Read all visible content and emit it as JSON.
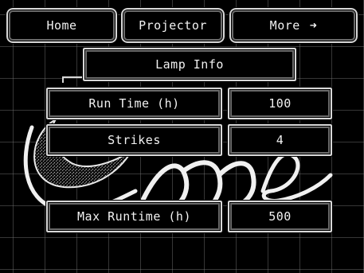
{
  "nav": {
    "home_label": "Home",
    "projector_label": "Projector",
    "more_label": "More",
    "more_icon": "arrow-right-icon"
  },
  "panel": {
    "title": "Lamp Info",
    "rows": [
      {
        "label": "Run Time (h)",
        "value": "100"
      },
      {
        "label": "Strikes",
        "value": "4"
      },
      {
        "label": "Max Runtime (h)",
        "value": "500"
      }
    ]
  },
  "colors": {
    "background": "#000000",
    "foreground": "#f2f2f2",
    "border": "#d8d8d8",
    "grid": "#787878"
  }
}
